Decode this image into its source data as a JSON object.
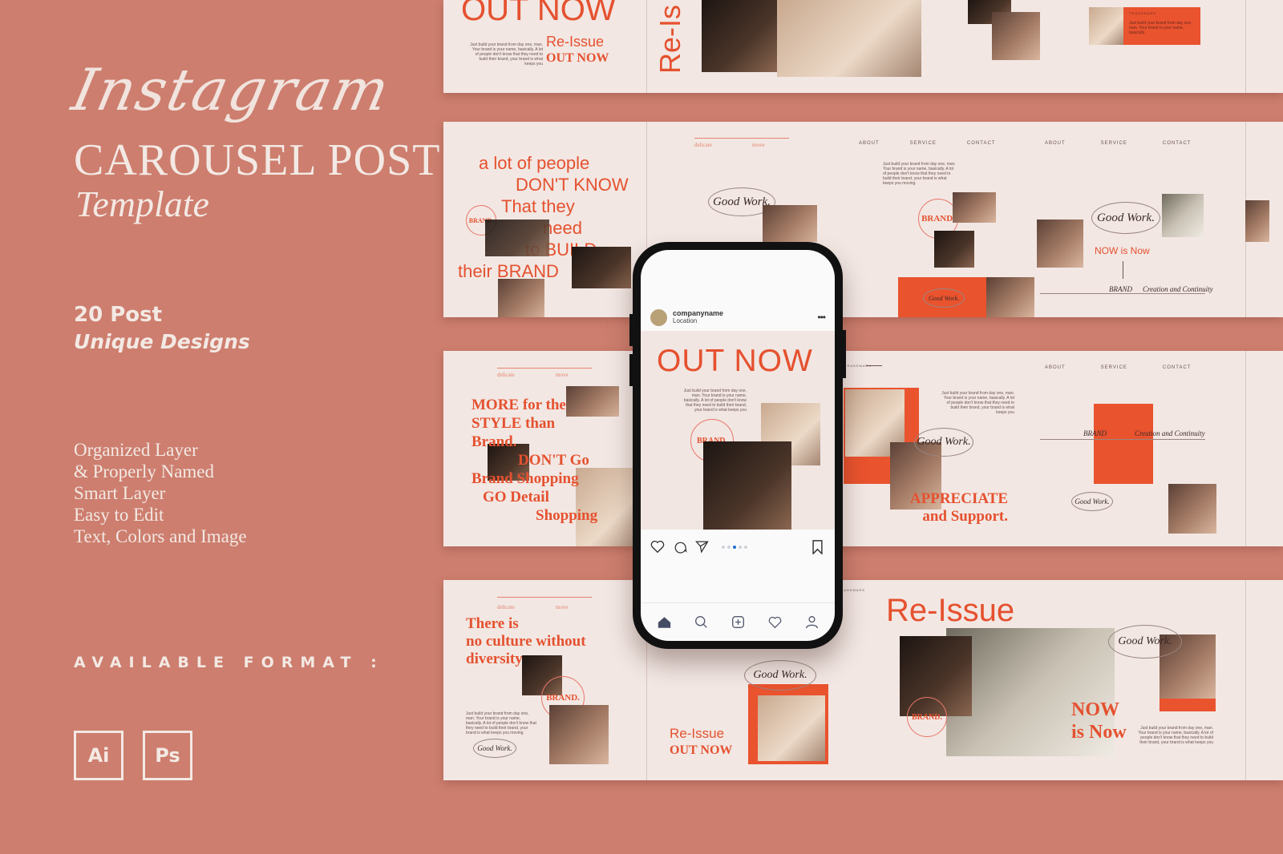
{
  "colors": {
    "background": "#cd7e6e",
    "cream": "#f2e7e3",
    "accent": "#e5512f",
    "text_light": "#f3e9e4"
  },
  "hero": {
    "script_title": "Instagram",
    "title": "CAROUSEL POST",
    "subtitle": "Template",
    "count": "20 Post",
    "count_caption": "Unique Designs",
    "features": [
      "Organized Layer",
      "& Properly Named",
      "Smart Layer",
      "Easy to Edit",
      "Text, Colors and Image"
    ],
    "formats_label": "AVAILABLE FORMAT :",
    "formats": [
      {
        "label": "Ai",
        "icon": "illustrator-icon"
      },
      {
        "label": "Ps",
        "icon": "photoshop-icon"
      }
    ]
  },
  "common": {
    "body_copy": "Just build your brand from day one, man. Your brand is your name, basically. A lot of people don't know that they need to build their brand, your brand is what keeps you",
    "body_copy_moving": "Just build your brand from day one, man. Your brand is your name, basically. A lot of people don't know that they need to build their brand, your brand is what keeps you moving.",
    "short_copy": "Just build your brand from day one, man. Your brand is your name, basically.",
    "good_work": "Good Work.",
    "brand_stamp": "BRAND.",
    "brand_word": "BRAND",
    "delicate": "delicate",
    "move": "move",
    "trademark": "TRADEMARK",
    "nav": [
      "ABOUT",
      "SERVICE",
      "CONTACT"
    ],
    "creation": "Creation and Continuity"
  },
  "row1": {
    "out_now": "OUT NOW",
    "re_issue": "Re-Issue",
    "out_now_bold": "OUT NOW",
    "re_is_vertical": "Re-Is"
  },
  "row2": {
    "lines": [
      "a lot of people",
      "DON'T KNOW",
      "That they",
      "need",
      "to BUILD",
      "their BRAND"
    ],
    "now_is_now": "NOW is Now"
  },
  "row3": {
    "lines": [
      "MORE for the",
      "STYLE than",
      "Brand.",
      "DON'T Go",
      "Brand Shopping",
      "GO Detail",
      "Shopping"
    ],
    "appreciate": "APPRECIATE",
    "support": "and Support."
  },
  "row4": {
    "lines": [
      "There is",
      "no culture without",
      "diversity"
    ],
    "brand_dot": "BRAND.",
    "re_issue": "Re-Issue",
    "out_now": "OUT NOW",
    "re_issue_big": "Re-Issue",
    "now": "NOW",
    "is_now": "is Now"
  },
  "phone": {
    "username": "companyname",
    "location": "Location",
    "more_icon": "more-options-icon",
    "post_title": "OUT NOW",
    "carousel": {
      "total": 5,
      "active": 3
    },
    "tabs": [
      "home-icon",
      "search-icon",
      "add-post-icon",
      "heart-icon",
      "profile-icon"
    ]
  }
}
